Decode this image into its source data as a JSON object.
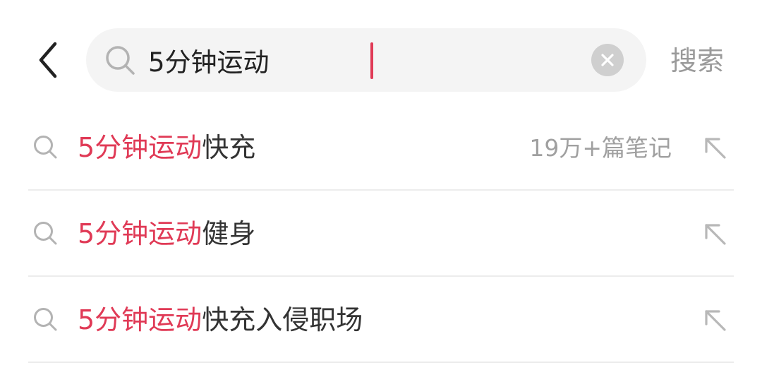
{
  "search": {
    "query": "5分钟运动",
    "submit_label": "搜索"
  },
  "icons": {
    "back": "chevron-left-icon",
    "search": "search-icon",
    "clear": "close-icon",
    "fill": "arrow-up-left-icon"
  },
  "colors": {
    "highlight": "#e03a56",
    "text": "#333333",
    "muted": "#a0a0a0",
    "search_bg": "#f4f4f4",
    "divider": "#ececec"
  },
  "suggestions": [
    {
      "highlight": "5分钟运动",
      "rest": "快充",
      "count": "19万+篇笔记"
    },
    {
      "highlight": "5分钟运动",
      "rest": "健身",
      "count": ""
    },
    {
      "highlight": "5分钟运动",
      "rest": "快充入侵职场",
      "count": ""
    }
  ]
}
